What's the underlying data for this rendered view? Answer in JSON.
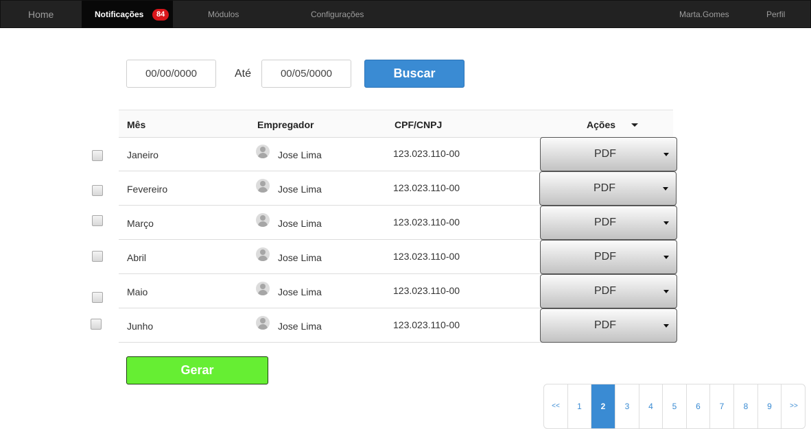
{
  "nav": {
    "home": "Home",
    "notifications": "Notificações",
    "notifications_badge": "84",
    "modules": "Módulos",
    "settings": "Configurações",
    "user": "Marta.Gomes",
    "profile": "Perfil"
  },
  "search": {
    "date_from": "00/00/0000",
    "date_to": "00/05/0000",
    "until_label": "Até",
    "button": "Buscar"
  },
  "table": {
    "headers": {
      "month": "Mês",
      "employer": "Empregador",
      "cpf": "CPF/CNPJ",
      "actions": "Ações"
    },
    "rows": [
      {
        "month": "Janeiro",
        "employer": "Jose Lima",
        "cpf": "123.023.110-00",
        "action": "PDF"
      },
      {
        "month": "Fevereiro",
        "employer": "Jose Lima",
        "cpf": "123.023.110-00",
        "action": "PDF"
      },
      {
        "month": "Março",
        "employer": "Jose Lima",
        "cpf": "123.023.110-00",
        "action": "PDF"
      },
      {
        "month": "Abril",
        "employer": "Jose Lima",
        "cpf": "123.023.110-00",
        "action": "PDF"
      },
      {
        "month": "Maio",
        "employer": "Jose Lima",
        "cpf": "123.023.110-00",
        "action": "PDF"
      },
      {
        "month": "Junho",
        "employer": "Jose Lima",
        "cpf": "123.023.110-00",
        "action": "PDF"
      }
    ]
  },
  "generate_button": "Gerar",
  "pagination": {
    "first": "<<",
    "last": ">>",
    "pages": [
      "1",
      "2",
      "3",
      "4",
      "5",
      "6",
      "7",
      "8",
      "9"
    ],
    "current": "2"
  },
  "colors": {
    "navbar": "#222222",
    "primary": "#3a8bd3",
    "generate": "#66ee33",
    "badge": "#d9161b"
  }
}
